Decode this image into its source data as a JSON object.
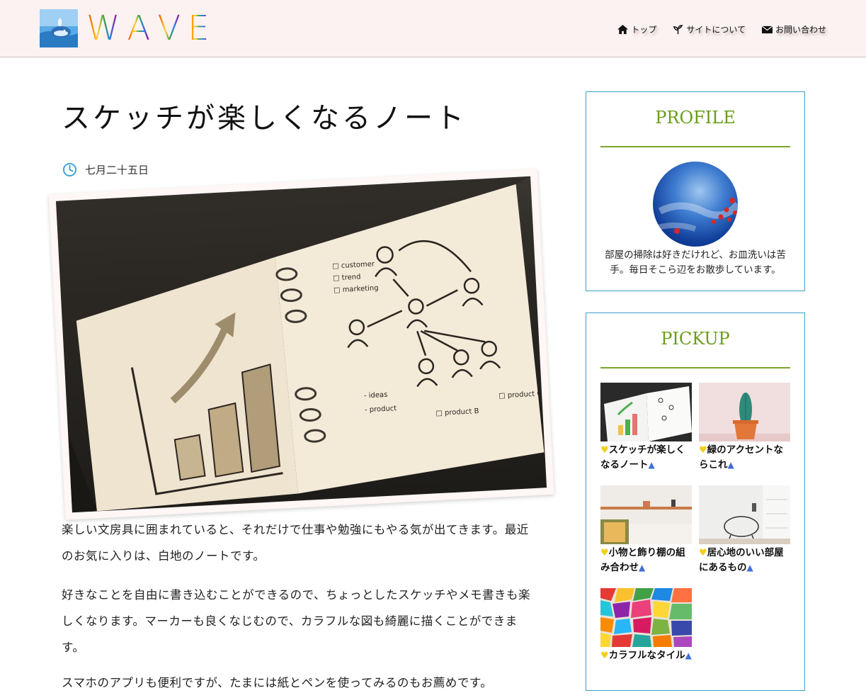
{
  "header": {
    "logo_text": [
      "W",
      "A",
      "V",
      "E"
    ],
    "nav": [
      {
        "label": "トップ",
        "icon": "home-icon"
      },
      {
        "label": "サイトについて",
        "icon": "sprout-icon"
      },
      {
        "label": "お問い合わせ",
        "icon": "envelope-icon"
      }
    ]
  },
  "article": {
    "title": "スケッチが楽しくなるノート",
    "date": "七月二十五日",
    "paragraphs": [
      "楽しい文房具に囲まれていると、それだけで仕事や勉強にもやる気が出てきます。最近のお気に入りは、白地のノートです。",
      "好きなことを自由に書き込むことができるので、ちょっとしたスケッチやメモ書きも楽しくなります。マーカーも良くなじむので、カラフルな図も綺麗に描くことができます。",
      "スマホのアプリも便利ですが、たまには紙とペンを使ってみるのもお薦めです。"
    ]
  },
  "sidebar": {
    "profile": {
      "title": "PROFILE",
      "text": "部屋の掃除は好きだけれど、お皿洗いは苦手。毎日そこら辺をお散歩しています。"
    },
    "pickup": {
      "title": "PICKUP",
      "items": [
        {
          "title": "スケッチが楽しくなるノート"
        },
        {
          "title": "緑のアクセントならこれ"
        },
        {
          "title": "小物と飾り棚の組み合わせ"
        },
        {
          "title": "居心地のいい部屋にあるもの"
        },
        {
          "title": "カラフルなタイル"
        }
      ]
    }
  },
  "colors": {
    "header_bg": "#fdf2f2",
    "widget_border": "#3aa1c5",
    "widget_title": "#6a9d1a",
    "clock_icon": "#3aa1d6"
  }
}
